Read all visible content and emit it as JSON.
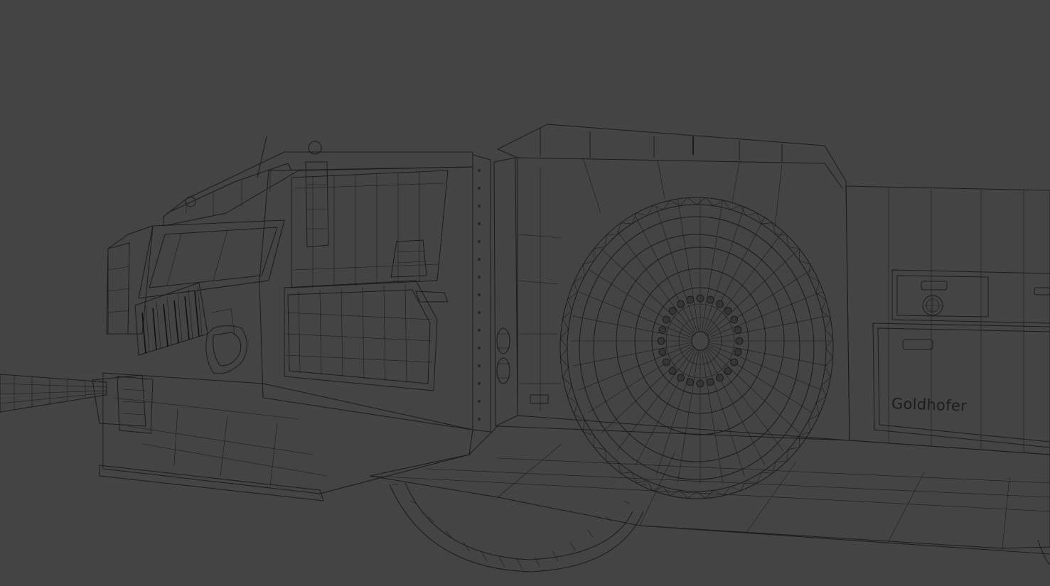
{
  "scene": {
    "background": "#444444",
    "wire_color": "#1b1b1b",
    "render_mode": "wireframe"
  },
  "vehicle": {
    "brand_label": "Goldhofer"
  }
}
